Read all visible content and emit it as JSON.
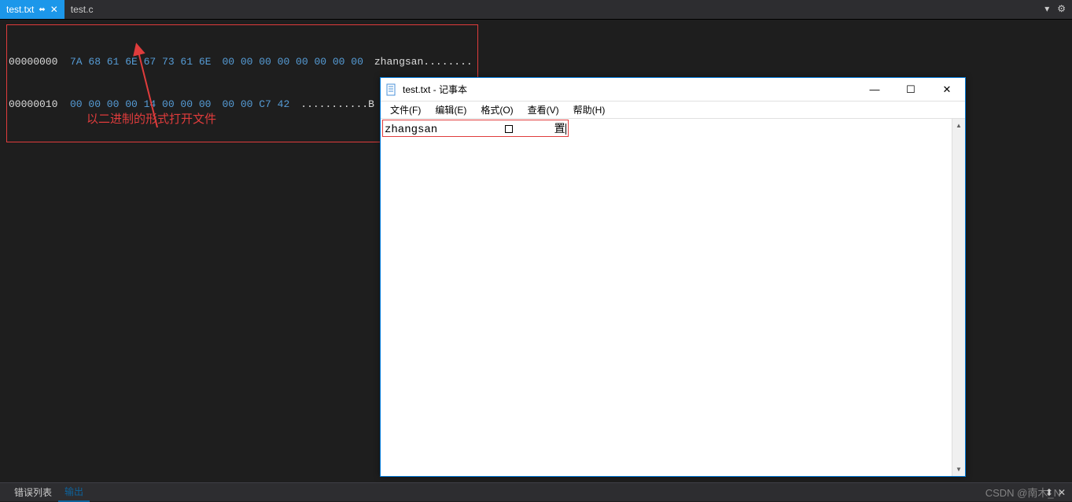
{
  "tabs": [
    {
      "label": "test.txt",
      "active": true,
      "pinned": true
    },
    {
      "label": "test.c",
      "active": false,
      "pinned": false
    }
  ],
  "hex_dump": {
    "rows": [
      {
        "offset": "00000000",
        "bytes1": "7A 68 61 6E 67 73 61 6E",
        "bytes2": "00 00 00 00 00 00 00 00",
        "ascii": "zhangsan........"
      },
      {
        "offset": "00000010",
        "bytes1": "00 00 00 00 14 00 00 00",
        "bytes2": "00 00 C7 42",
        "ascii": "...........B"
      }
    ]
  },
  "annotation": {
    "text": "以二进制的形式打开文件"
  },
  "notepad": {
    "title": "test.txt - 记事本",
    "menu": [
      "文件(F)",
      "编辑(E)",
      "格式(O)",
      "查看(V)",
      "帮助(H)"
    ],
    "content_parts": {
      "text1": "zhangsan",
      "char2": "置"
    }
  },
  "bottom_panel": {
    "tabs": [
      {
        "label": "错误列表",
        "active": false
      },
      {
        "label": "输出",
        "active": true
      }
    ]
  },
  "watermark": "CSDN @南木_N",
  "icons": {
    "dropdown": "▾",
    "gear": "⚙",
    "pin": "📌",
    "close_x": "✕",
    "minimize": "—",
    "maximize": "☐",
    "up": "▲",
    "down": "▼"
  }
}
